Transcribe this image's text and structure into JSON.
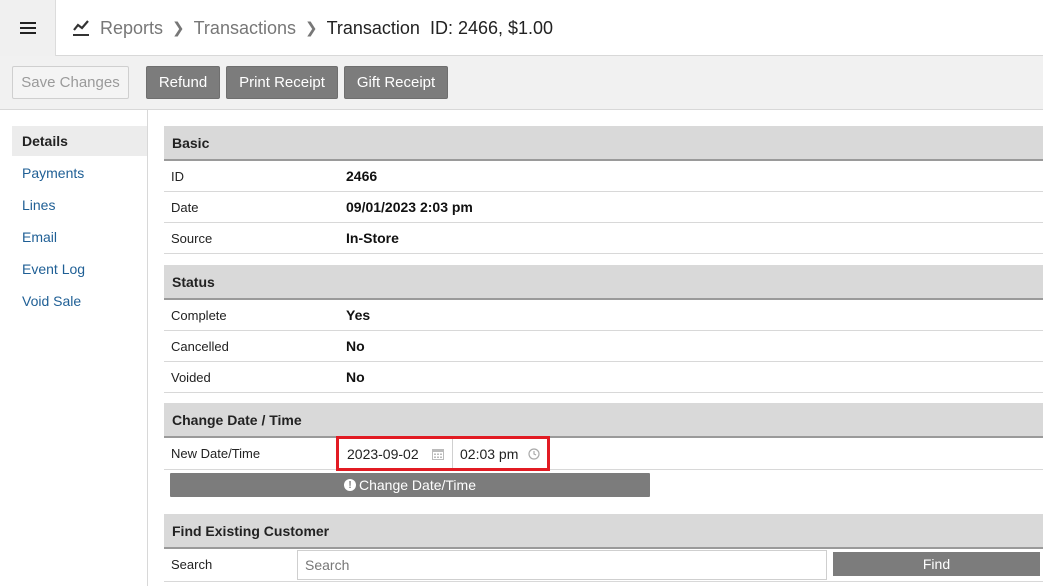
{
  "header": {
    "breadcrumb": [
      "Reports",
      "Transactions"
    ],
    "title": "Transaction  ID: 2466, $1.00"
  },
  "toolbar": {
    "save_label": "Save Changes",
    "refund_label": "Refund",
    "print_label": "Print Receipt",
    "gift_label": "Gift Receipt"
  },
  "sidebar": {
    "items": [
      {
        "label": "Details",
        "active": true
      },
      {
        "label": "Payments"
      },
      {
        "label": "Lines"
      },
      {
        "label": "Email"
      },
      {
        "label": "Event Log"
      },
      {
        "label": "Void Sale"
      }
    ]
  },
  "basic": {
    "heading": "Basic",
    "rows": [
      {
        "label": "ID",
        "value": "2466"
      },
      {
        "label": "Date",
        "value": "09/01/2023 2:03 pm"
      },
      {
        "label": "Source",
        "value": "In-Store"
      }
    ]
  },
  "status": {
    "heading": "Status",
    "rows": [
      {
        "label": "Complete",
        "value": "Yes"
      },
      {
        "label": "Cancelled",
        "value": "No"
      },
      {
        "label": "Voided",
        "value": "No"
      }
    ]
  },
  "change_dt": {
    "heading": "Change Date / Time",
    "label": "New Date/Time",
    "date_value": "2023-09-02",
    "time_value": "02:03 pm",
    "button_label": "Change Date/Time",
    "highlight_color": "#e21b23"
  },
  "customer": {
    "heading": "Find Existing Customer",
    "search_label": "Search",
    "search_placeholder": "Search",
    "find_label": "Find"
  }
}
